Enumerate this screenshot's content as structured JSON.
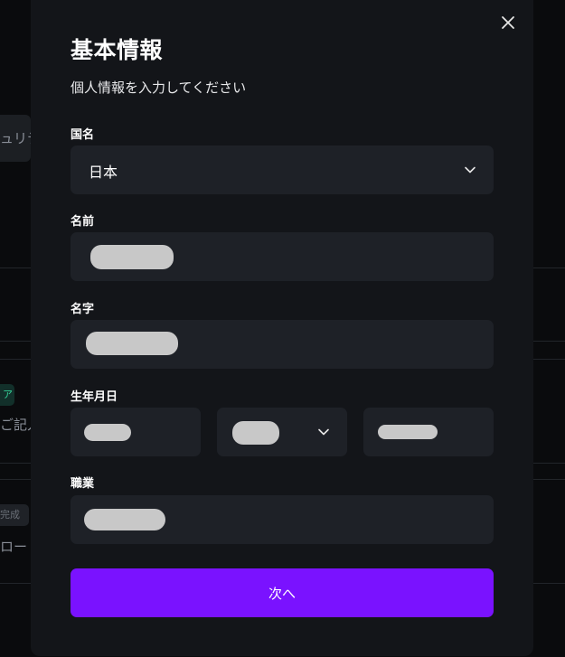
{
  "background": {
    "left_texts": [
      "ュリテ",
      "ご記入",
      "ロード"
    ],
    "tags": [
      "ア",
      "完成"
    ]
  },
  "modal": {
    "title": "基本情報",
    "subtitle": "個人情報を入力してください",
    "fields": {
      "country": {
        "label": "国名",
        "value": "日本"
      },
      "first_name": {
        "label": "名前"
      },
      "last_name": {
        "label": "名字"
      },
      "birthdate": {
        "label": "生年月日"
      },
      "occupation": {
        "label": "職業"
      }
    },
    "next_label": "次へ"
  },
  "colors": {
    "accent": "#7a12ff",
    "modal_bg": "#131519",
    "field_bg": "#1e2127",
    "redaction": "#c8c8c8"
  }
}
